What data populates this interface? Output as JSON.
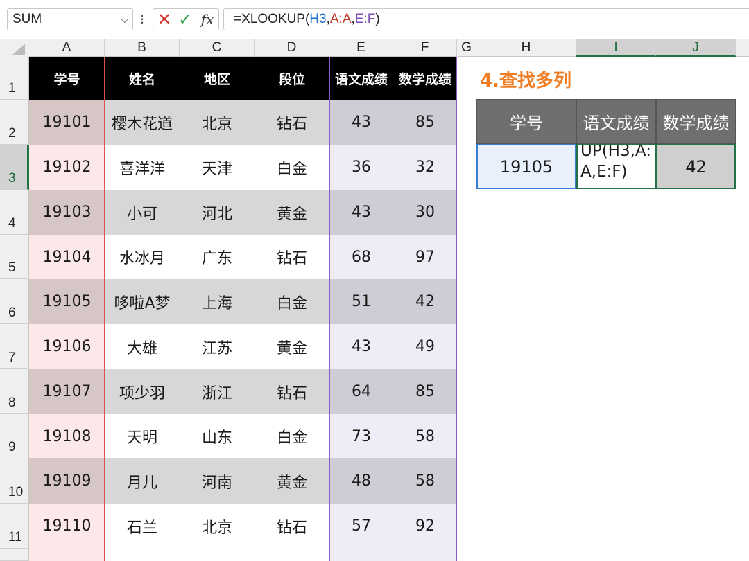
{
  "formula_bar": {
    "name_box": "SUM",
    "formula_prefix": "=XLOOKUP(",
    "formula_ref1": "H3",
    "formula_comma1": ",",
    "formula_ref2": "A:A",
    "formula_comma2": ",",
    "formula_ref3": "E:F",
    "formula_suffix": ")"
  },
  "columns": [
    "A",
    "B",
    "C",
    "D",
    "E",
    "F",
    "G",
    "H",
    "I",
    "J"
  ],
  "rows": [
    "1",
    "2",
    "3",
    "4",
    "5",
    "6",
    "7",
    "8",
    "9",
    "10",
    "11"
  ],
  "table": {
    "headers": [
      "学号",
      "姓名",
      "地区",
      "段位",
      "语文成绩",
      "数学成绩"
    ],
    "data": [
      [
        "19101",
        "樱木花道",
        "北京",
        "钻石",
        "43",
        "85"
      ],
      [
        "19102",
        "喜洋洋",
        "天津",
        "白金",
        "36",
        "32"
      ],
      [
        "19103",
        "小可",
        "河北",
        "黄金",
        "43",
        "30"
      ],
      [
        "19104",
        "水冰月",
        "广东",
        "钻石",
        "68",
        "97"
      ],
      [
        "19105",
        "哆啦A梦",
        "上海",
        "白金",
        "51",
        "42"
      ],
      [
        "19106",
        "大雄",
        "江苏",
        "黄金",
        "43",
        "49"
      ],
      [
        "19107",
        "项少羽",
        "浙江",
        "钻石",
        "64",
        "85"
      ],
      [
        "19108",
        "天明",
        "山东",
        "白金",
        "73",
        "58"
      ],
      [
        "19109",
        "月儿",
        "河南",
        "黄金",
        "48",
        "58"
      ],
      [
        "19110",
        "石兰",
        "北京",
        "钻石",
        "57",
        "92"
      ]
    ]
  },
  "lookup": {
    "title": "4.查找多列",
    "headers": [
      "学号",
      "语文成绩",
      "数学成绩"
    ],
    "id_value": "19105",
    "editing_text_line1": "UP(H3,A:",
    "editing_text_line2": "A,E:F)",
    "math_value": "42"
  },
  "colors": {
    "header_bg": "#000000",
    "title_orange": "#f07d24",
    "excel_green": "#217346",
    "ref_blue": "#1f6fc9",
    "ref_red": "#c0392b",
    "ref_purple": "#7b4fb6"
  }
}
